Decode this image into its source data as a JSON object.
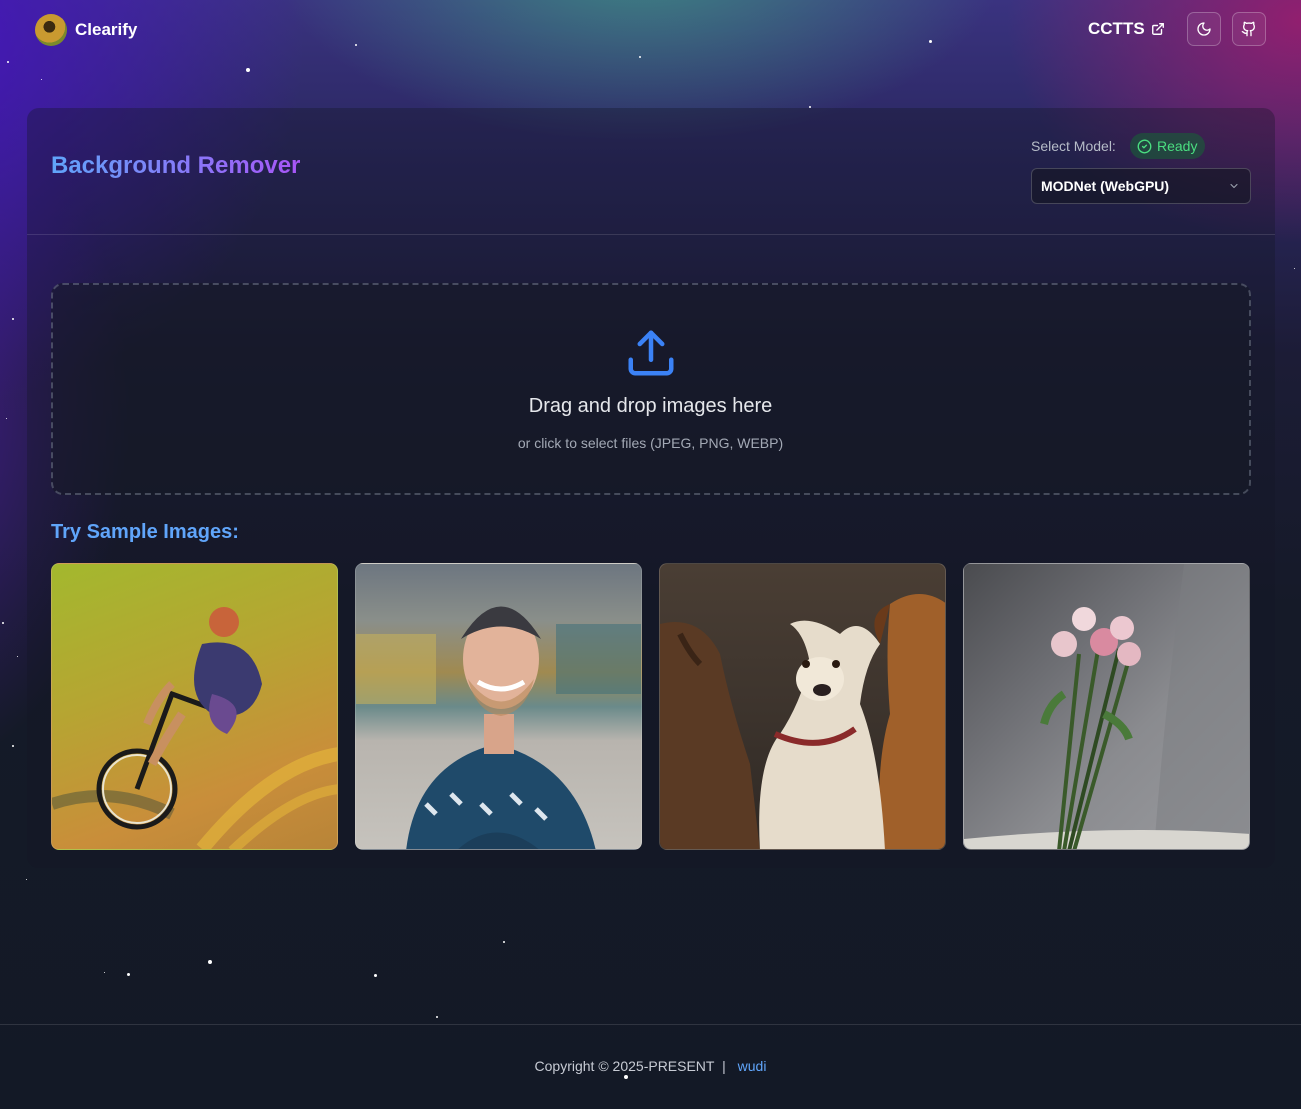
{
  "header": {
    "brand_name": "Clearify",
    "external_link_label": "CCTTS",
    "theme_toggle_icon": "moon-icon",
    "repo_icon": "github-icon"
  },
  "main": {
    "title": "Background Remover",
    "model_label": "Select Model:",
    "status_label": "Ready",
    "model_select_value": "MODNet (WebGPU)",
    "dropzone": {
      "title": "Drag and drop images here",
      "subtitle": "or click to select files (JPEG, PNG, WEBP)"
    },
    "samples_heading": "Try Sample Images:",
    "samples": [
      {
        "name": "sample-image-cyclist"
      },
      {
        "name": "sample-image-man"
      },
      {
        "name": "sample-image-dogs"
      },
      {
        "name": "sample-image-roses"
      }
    ]
  },
  "footer": {
    "copyright": "Copyright © 2025-PRESENT",
    "separator": "|",
    "author": "wudi"
  },
  "colors": {
    "accent_blue": "#60a5fa",
    "accent_purple": "#a855f7",
    "ready_green": "#4ade80"
  }
}
